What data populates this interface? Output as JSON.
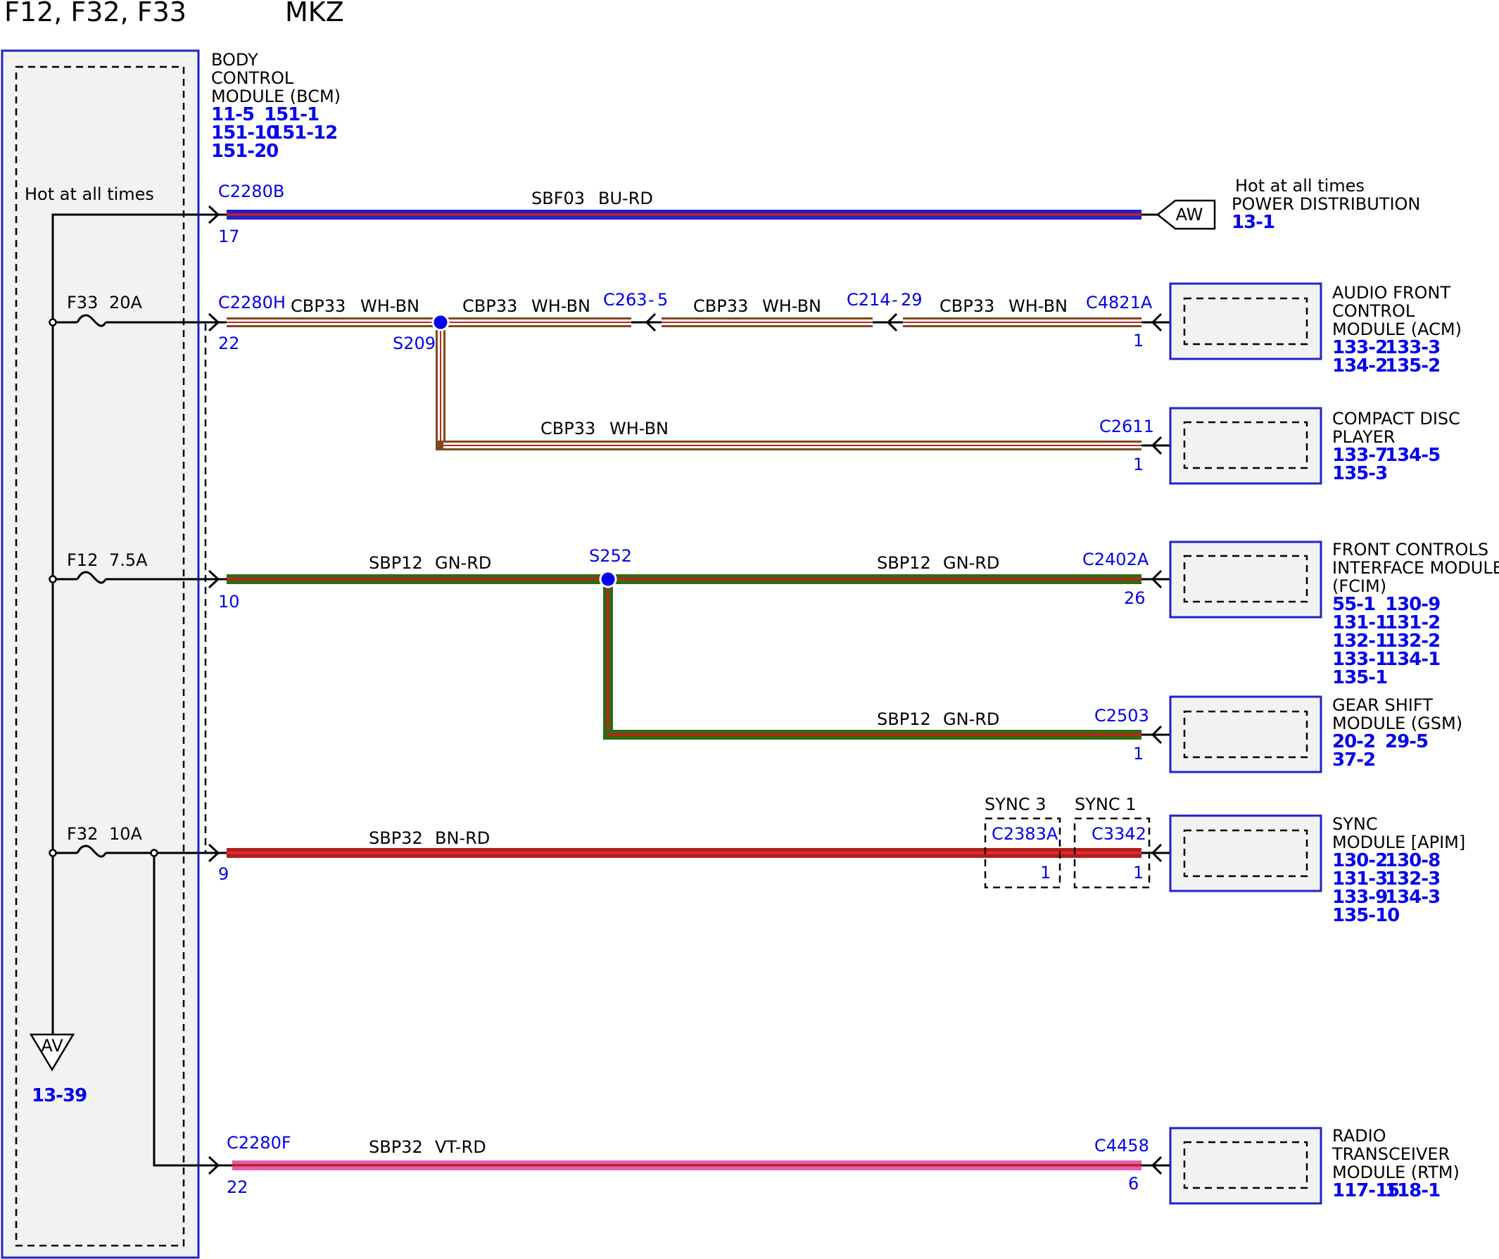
{
  "header": {
    "fuses": "F12, F32, F33",
    "model": "MKZ"
  },
  "bcm": {
    "title": [
      "BODY",
      "CONTROL",
      "MODULE (BCM)"
    ],
    "refs": [
      "11-5",
      "151-1",
      "151-10",
      "151-12",
      "151-20"
    ],
    "hot_label": "Hot at all times"
  },
  "fuses": {
    "f33": {
      "name": "F33",
      "rating": "20A"
    },
    "f12": {
      "name": "F12",
      "rating": "7.5A"
    },
    "f32": {
      "name": "F32",
      "rating": "10A"
    }
  },
  "ground": {
    "symbol": "AV",
    "ref": "13-39"
  },
  "circuits": {
    "sbf03": {
      "connector": "C2280B",
      "pin": "17",
      "wire": "SBF03",
      "color": "BU-RD"
    },
    "cbp33": {
      "connector": "C2280H",
      "pin": "22",
      "wire": "CBP33",
      "color": "WH-BN",
      "splice": "S209",
      "inline1": "C263",
      "inline1_pin": "5",
      "inline2": "C214",
      "inline2_pin": "29",
      "end_connector": "C4821A",
      "end_pin": "1",
      "branch_connector": "C2611",
      "branch_pin": "1"
    },
    "sbp12": {
      "pin": "10",
      "wire": "SBP12",
      "color": "GN-RD",
      "splice": "S252",
      "end_connector": "C2402A",
      "end_pin": "26",
      "branch_connector": "C2503",
      "branch_pin": "1"
    },
    "sbp32_bn": {
      "pin": "9",
      "wire": "SBP32",
      "color": "BN-RD",
      "sync3_label": "SYNC 3",
      "sync3_connector": "C2383A",
      "sync3_pin": "1",
      "sync1_label": "SYNC 1",
      "sync1_connector": "C3342",
      "sync1_pin": "1"
    },
    "sbp32_vt": {
      "connector": "C2280F",
      "pin": "22",
      "wire": "SBP32",
      "color": "VT-RD",
      "end_connector": "C4458",
      "end_pin": "6"
    }
  },
  "power_distribution": {
    "symbol": "AW",
    "label": [
      "Hot at all times",
      "POWER DISTRIBUTION"
    ],
    "ref": "13-1"
  },
  "modules": {
    "acm": {
      "title": [
        "AUDIO FRONT",
        "CONTROL",
        "MODULE (ACM)"
      ],
      "refs": [
        "133-2",
        "133-3",
        "134-2",
        "135-2"
      ]
    },
    "cdp": {
      "title": [
        "COMPACT DISC",
        "PLAYER"
      ],
      "refs": [
        "133-7",
        "134-5",
        "135-3"
      ]
    },
    "fcim": {
      "title": [
        "FRONT CONTROLS",
        "INTERFACE MODULE",
        "(FCIM)"
      ],
      "refs": [
        "55-1",
        "130-9",
        "131-1",
        "131-2",
        "132-1",
        "132-2",
        "133-1",
        "134-1",
        "135-1"
      ]
    },
    "gsm": {
      "title": [
        "GEAR SHIFT",
        "MODULE (GSM)"
      ],
      "refs": [
        "20-2",
        "29-5",
        "37-2"
      ]
    },
    "apim": {
      "title": [
        "SYNC",
        "MODULE [APIM]"
      ],
      "refs": [
        "130-2",
        "130-8",
        "131-3",
        "132-3",
        "133-9",
        "134-3",
        "135-10"
      ]
    },
    "rtm": {
      "title": [
        "RADIO",
        "TRANSCEIVER",
        "MODULE (RTM)"
      ],
      "refs": [
        "117-15",
        "118-1"
      ]
    }
  },
  "wire_colors": {
    "blue": "#2020c8",
    "red": "#c81e1e",
    "green": "#2e6b12",
    "white": "#ffffff",
    "brown": "#7a4a1e",
    "violet": "#e060b0",
    "module_border": "#2222cc",
    "label_blue": "#0000ee"
  }
}
